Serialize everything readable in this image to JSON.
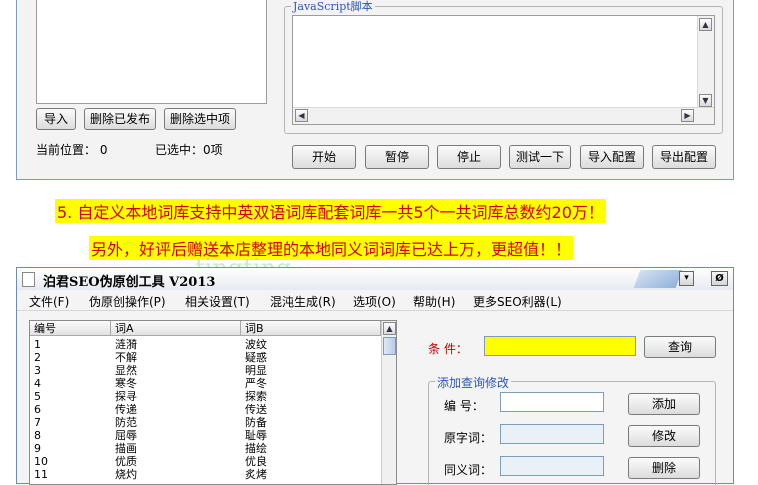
{
  "top_panel": {
    "group_title": "JavaScript脚本",
    "buttons_left": [
      "导入",
      "删除已发布",
      "删除选中项"
    ],
    "current_position": "当前位置： 0",
    "selected": "已选中：0项",
    "buttons_bottom": [
      "开始",
      "暂停",
      "停止",
      "测试一下",
      "导入配置",
      "导出配置"
    ]
  },
  "banners": [
    "5. 自定义本地词库支持中英双语词库配套词库一共5个一共词库总数约20万！",
    "另外，好评后赠送本店整理的本地同义词词库已达上万，更超值！！"
  ],
  "watermark": "tingting",
  "window": {
    "title": "泊君SEO伪原创工具 V2013",
    "menu": [
      "文件(F)",
      "伪原创操作(P)",
      "相关设置(T)",
      "混沌生成(R)",
      "选项(O)",
      "帮助(H)",
      "更多SEO利器(L)"
    ],
    "columns": [
      "编号",
      "词A",
      "词B"
    ],
    "rows": [
      [
        "1",
        "涟漪",
        "波纹"
      ],
      [
        "2",
        "不解",
        "疑惑"
      ],
      [
        "3",
        "显然",
        "明显"
      ],
      [
        "4",
        "寒冬",
        "严冬"
      ],
      [
        "5",
        "探寻",
        "探索"
      ],
      [
        "6",
        "传递",
        "传送"
      ],
      [
        "7",
        "防范",
        "防备"
      ],
      [
        "8",
        "屈辱",
        "耻辱"
      ],
      [
        "9",
        "描画",
        "描绘"
      ],
      [
        "10",
        "优质",
        "优良"
      ],
      [
        "11",
        "烧灼",
        "炙烤"
      ]
    ],
    "condition_label": "条  件：",
    "query_button": "查询",
    "add_group_title": "添加查询修改",
    "id_label": "编  号：",
    "orig_label": "原字词：",
    "syn_label": "同义词：",
    "add_button": "添加",
    "modify_button": "修改",
    "delete_button": "删除"
  },
  "colors": {
    "banner_bg": "#ffff00",
    "banner_text": "#d40000",
    "condition_field": "#ffff00",
    "label_red": "#c00000",
    "group_title": "#2b55b5"
  }
}
